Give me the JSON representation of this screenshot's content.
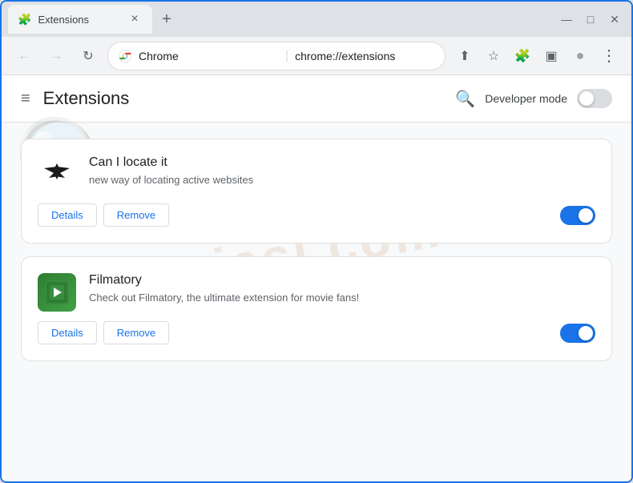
{
  "window": {
    "title": "Extensions",
    "tab_close": "×",
    "new_tab": "+",
    "controls": {
      "minimize": "—",
      "maximize": "□",
      "close": "✕",
      "restore": "❐"
    }
  },
  "navbar": {
    "back": "←",
    "forward": "→",
    "refresh": "↻",
    "browser_name": "Chrome",
    "url": "chrome://extensions",
    "divider": "|"
  },
  "nav_icons": {
    "share": "⬆",
    "star": "☆",
    "puzzle": "🧩",
    "sidebar": "▣",
    "profile": "●",
    "menu": "⋮"
  },
  "page": {
    "title": "Extensions",
    "hamburger": "≡",
    "search_icon": "🔍",
    "developer_mode_label": "Developer mode"
  },
  "developer_toggle": {
    "state": "off"
  },
  "extensions": [
    {
      "id": "ext1",
      "name": "Can I locate it",
      "description": "new way of locating active websites",
      "enabled": true,
      "details_label": "Details",
      "remove_label": "Remove"
    },
    {
      "id": "ext2",
      "name": "Filmatory",
      "description": "Check out Filmatory, the ultimate extension for movie fans!",
      "enabled": true,
      "details_label": "Details",
      "remove_label": "Remove"
    }
  ],
  "watermark": {
    "text": "riasl.com"
  }
}
